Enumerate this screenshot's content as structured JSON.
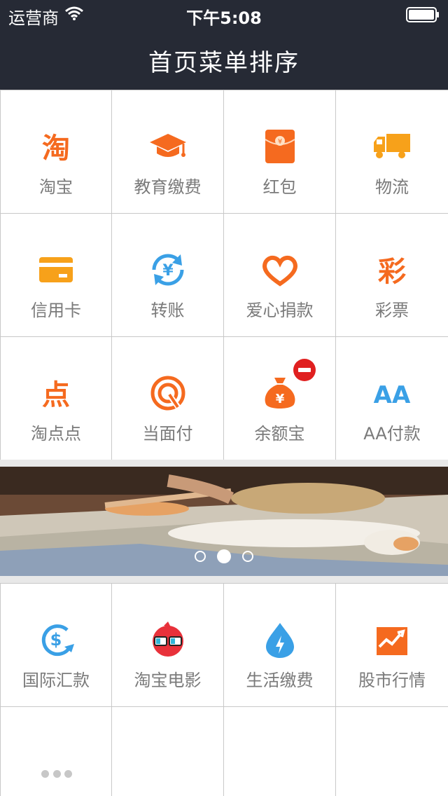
{
  "status_bar": {
    "carrier": "运营商",
    "time": "下午5:08",
    "wifi_icon": "wifi-icon",
    "battery_icon": "battery-icon"
  },
  "nav": {
    "title": "首页菜单排序"
  },
  "menu_grid": [
    {
      "label": "淘宝",
      "icon": "taobao-icon"
    },
    {
      "label": "教育缴费",
      "icon": "graduation-cap-icon"
    },
    {
      "label": "红包",
      "icon": "red-envelope-icon"
    },
    {
      "label": "物流",
      "icon": "truck-icon"
    },
    {
      "label": "信用卡",
      "icon": "credit-card-icon"
    },
    {
      "label": "转账",
      "icon": "transfer-icon"
    },
    {
      "label": "爱心捐款",
      "icon": "heart-icon"
    },
    {
      "label": "彩票",
      "icon": "lottery-icon"
    },
    {
      "label": "淘点点",
      "icon": "taodiandian-icon"
    },
    {
      "label": "当面付",
      "icon": "face-pay-icon"
    },
    {
      "label": "余额宝",
      "icon": "money-bag-icon",
      "badge": "remove-badge-icon"
    },
    {
      "label": "AA付款",
      "icon": "aa-icon"
    }
  ],
  "banner": {
    "dots": 3,
    "active_dot": 2,
    "caption_icon": "weibo-watermark-icon"
  },
  "more_grid": [
    {
      "label": "国际汇款",
      "icon": "international-remit-icon"
    },
    {
      "label": "淘宝电影",
      "icon": "movie-icon"
    },
    {
      "label": "生活缴费",
      "icon": "utility-drop-icon"
    },
    {
      "label": "股市行情",
      "icon": "stock-chart-icon"
    }
  ],
  "more_button": {
    "icon": "more-icon"
  },
  "colors": {
    "nav_bg": "#262a35",
    "orange": "#f56a1f",
    "amber": "#f7a11a",
    "blue": "#3aa0e6",
    "red": "#e02020"
  }
}
